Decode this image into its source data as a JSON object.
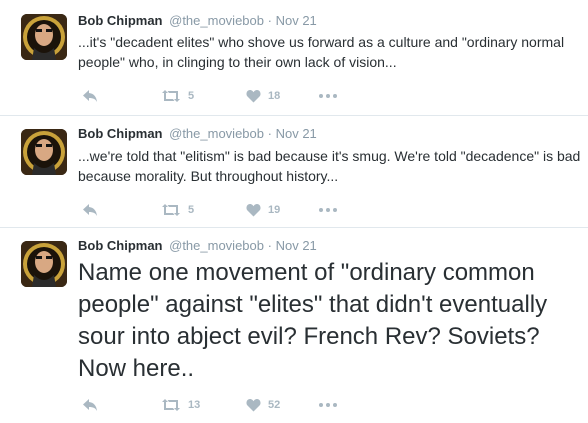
{
  "tweets": [
    {
      "name": "Bob Chipman",
      "handle": "@the_moviebob",
      "separator": "·",
      "time": "Nov 21",
      "text": "...it's \"decadent elites\" who shove us forward as a culture and \"ordinary normal people\" who, in clinging to their own lack of vision...",
      "retweets": "5",
      "likes": "18",
      "large": false
    },
    {
      "name": "Bob Chipman",
      "handle": "@the_moviebob",
      "separator": "·",
      "time": "Nov 21",
      "text": "...we're told that \"elitism\" is bad because it's smug. We're told \"decadence\" is bad because morality. But throughout history...",
      "retweets": "5",
      "likes": "19",
      "large": false
    },
    {
      "name": "Bob Chipman",
      "handle": "@the_moviebob",
      "separator": "·",
      "time": "Nov 21",
      "text": "Name one movement of \"ordinary common people\" against \"elites\" that didn't eventually sour into abject evil? French Rev? Soviets? Now here..",
      "retweets": "13",
      "likes": "52",
      "large": true
    }
  ],
  "icons": {
    "reply": "reply-icon",
    "retweet": "retweet-icon",
    "like": "heart-icon",
    "more": "more-icon"
  },
  "colors": {
    "text": "#292f33",
    "muted": "#8899a6",
    "action": "#aab8c2",
    "separator": "#e1e8ed"
  }
}
